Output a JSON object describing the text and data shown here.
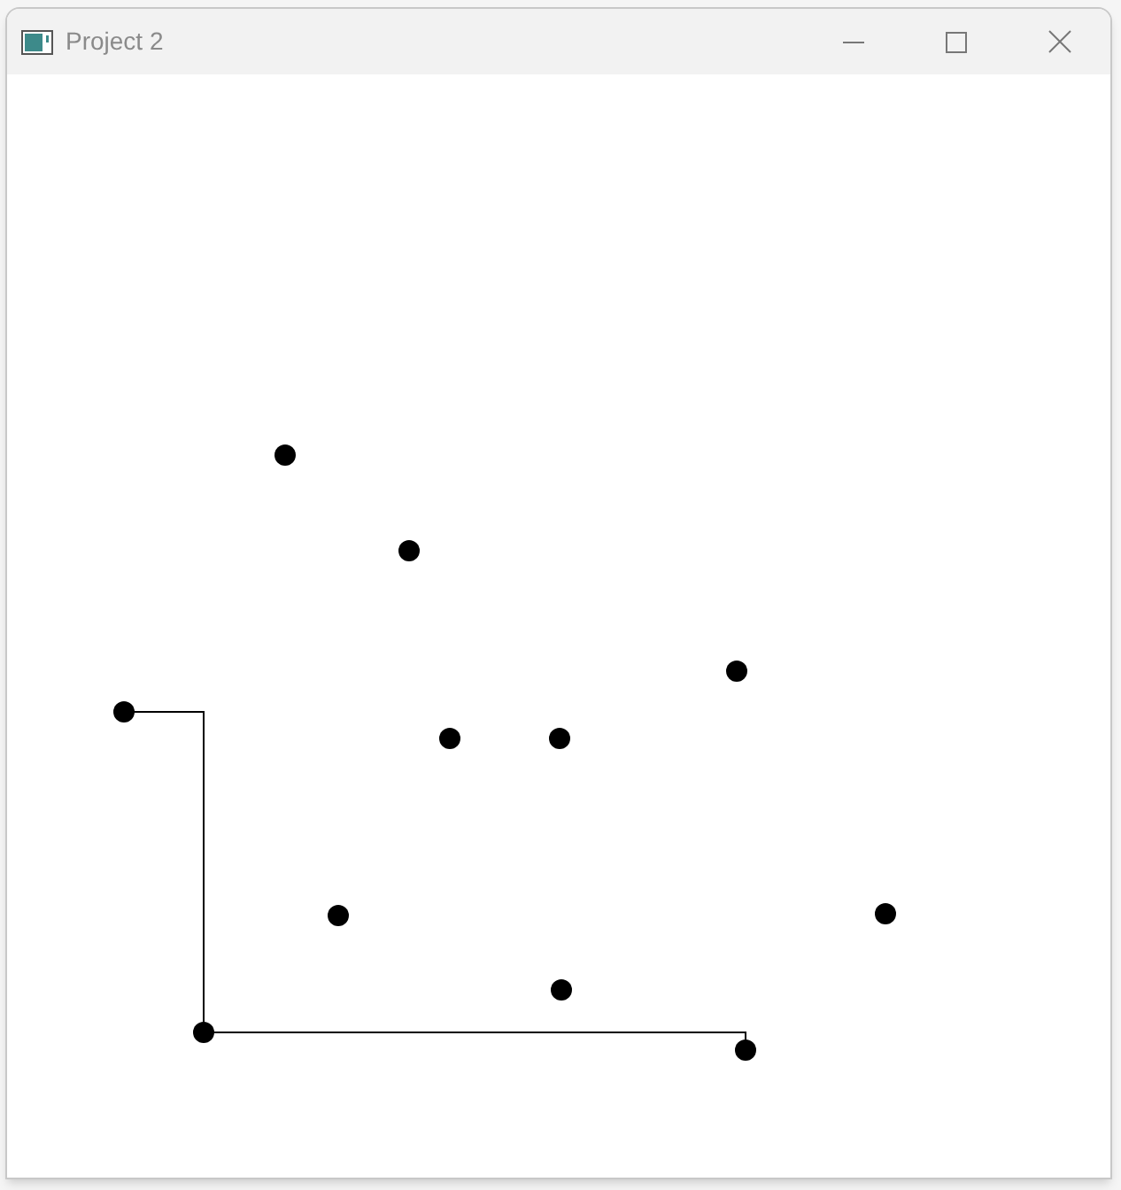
{
  "window": {
    "title": "Project 2"
  }
}
